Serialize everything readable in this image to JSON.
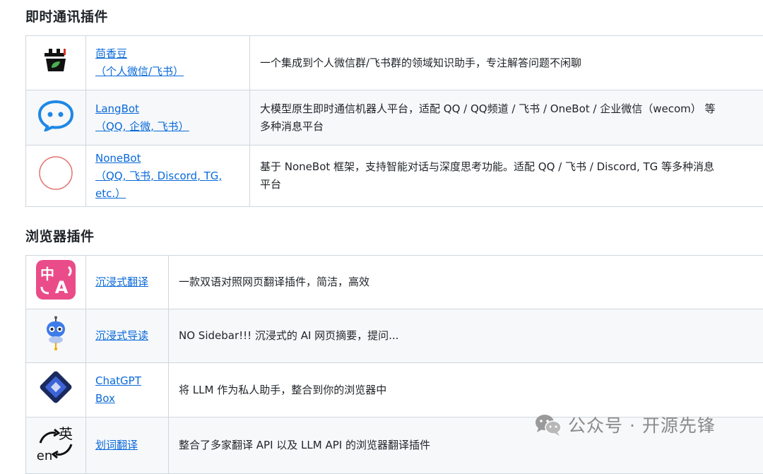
{
  "sections": {
    "im": {
      "title": "即时通讯插件"
    },
    "browser": {
      "title": "浏览器插件"
    }
  },
  "im_rows": [
    {
      "icon": "sprout-logo-icon",
      "name_lines": [
        "茴香豆",
        "（个人微信/飞书）"
      ],
      "desc_lines": [
        "一个集成到个人微信群/飞书群的领域知识助手，专注解答问题不闲聊"
      ]
    },
    {
      "icon": "chat-bubble-icon",
      "name_lines": [
        "LangBot",
        "（QQ, 企微, 飞书）"
      ],
      "desc_lines": [
        "大模型原生即时通信机器人平台，适配 QQ / QQ频道 / 飞书 / OneBot / 企业微信（wecom） 等",
        "多种消息平台"
      ]
    },
    {
      "icon": "circle-logo-icon",
      "name_lines": [
        "NoneBot",
        "（QQ, 飞书, Discord, TG,",
        "etc.）"
      ],
      "desc_lines": [
        "基于 NoneBot 框架，支持智能对话与深度思考功能。适配 QQ / 飞书 / Discord, TG 等多种消息",
        "平台"
      ]
    }
  ],
  "browser_rows": [
    {
      "icon": "translate-zh-a-icon",
      "name_lines": [
        "沉浸式翻译"
      ],
      "desc_lines": [
        "一款双语对照网页翻译插件，简洁，高效"
      ]
    },
    {
      "icon": "robot-mascot-icon",
      "name_lines": [
        "沉浸式导读"
      ],
      "desc_lines": [
        "NO Sidebar!!! 沉浸式的 AI 网页摘要，提问..."
      ]
    },
    {
      "icon": "diamond-logo-icon",
      "name_lines": [
        "ChatGPT",
        "Box"
      ],
      "desc_lines": [
        "将 LLM 作为私人助手，整合到你的浏览器中"
      ]
    },
    {
      "icon": "en-translate-icon",
      "name_lines": [
        "划词翻译"
      ],
      "desc_lines": [
        "整合了多家翻译 API 以及 LLM API 的浏览器翻译插件"
      ]
    }
  ],
  "watermark": {
    "text": "公众号 · 开源先锋",
    "icon": "wechat-icon"
  }
}
